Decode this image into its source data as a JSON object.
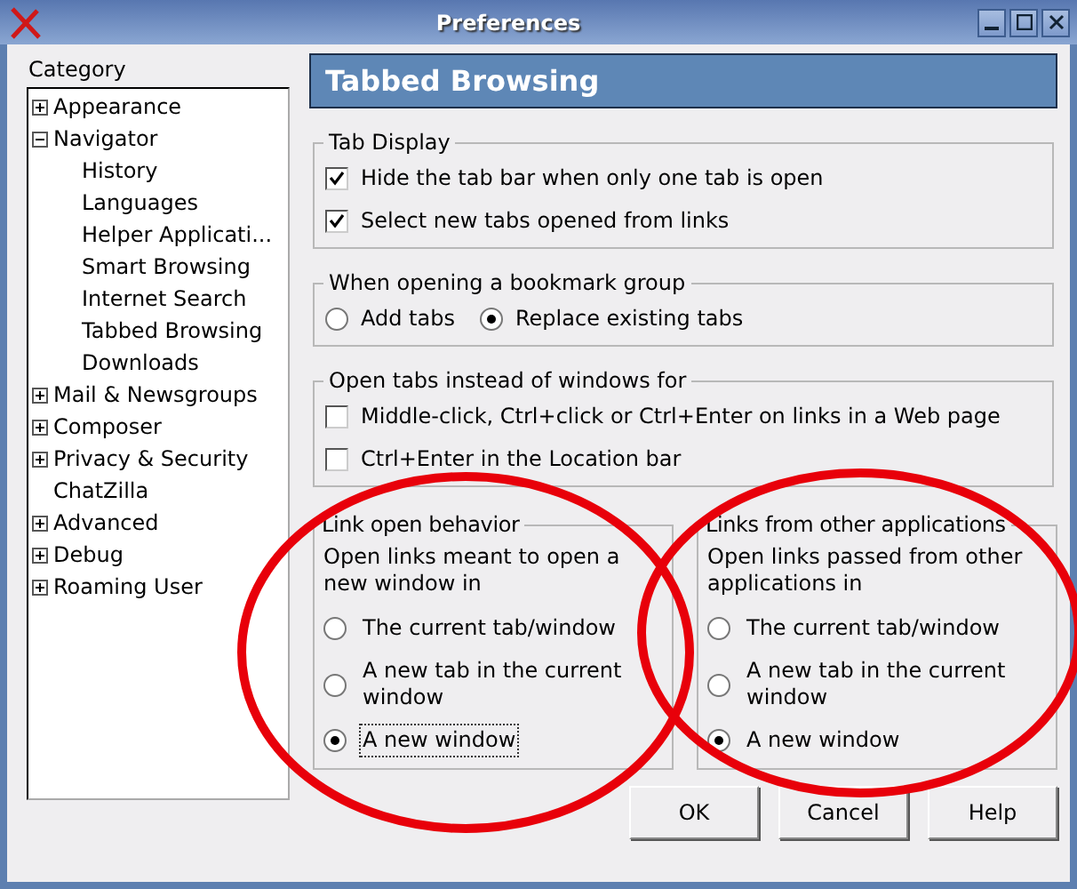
{
  "window": {
    "title": "Preferences"
  },
  "sidebar": {
    "label": "Category",
    "items": [
      {
        "label": "Appearance",
        "expanded": false
      },
      {
        "label": "Navigator",
        "expanded": true,
        "children": [
          {
            "label": "History"
          },
          {
            "label": "Languages"
          },
          {
            "label": "Helper Applicati..."
          },
          {
            "label": "Smart Browsing"
          },
          {
            "label": "Internet Search"
          },
          {
            "label": "Tabbed Browsing"
          },
          {
            "label": "Downloads"
          }
        ]
      },
      {
        "label": "Mail & Newsgroups",
        "expanded": false
      },
      {
        "label": "Composer",
        "expanded": false
      },
      {
        "label": "Privacy & Security",
        "expanded": false
      },
      {
        "label": "ChatZilla"
      },
      {
        "label": "Advanced",
        "expanded": false
      },
      {
        "label": "Debug",
        "expanded": false
      },
      {
        "label": "Roaming User",
        "expanded": false
      }
    ]
  },
  "panel_title": "Tabbed Browsing",
  "groups": [
    {
      "title": "Tab Display",
      "options": [
        {
          "kind": "checkbox",
          "label": "Hide the tab bar when only one tab is open",
          "checked": true
        },
        {
          "kind": "checkbox",
          "label": "Select new tabs opened from links",
          "checked": true
        }
      ]
    },
    {
      "title": "When opening a bookmark group",
      "options": [
        {
          "kind": "radio",
          "label": "Add tabs",
          "selected": false
        },
        {
          "kind": "radio",
          "label": "Replace existing tabs",
          "selected": true
        }
      ]
    },
    {
      "title": "Open tabs instead of windows for",
      "options": [
        {
          "kind": "checkbox",
          "label": "Middle-click, Ctrl+click or Ctrl+Enter on links in a Web page",
          "checked": false
        },
        {
          "kind": "checkbox",
          "label": "Ctrl+Enter in the Location bar",
          "checked": false
        }
      ]
    }
  ],
  "link_groups": [
    {
      "title": "Link open behavior",
      "description": "Open links meant to open a new window in",
      "options": [
        {
          "label": "The current tab/window",
          "selected": false,
          "focused": false
        },
        {
          "label": "A new tab in the current window",
          "selected": false,
          "focused": false
        },
        {
          "label": "A new window",
          "selected": true,
          "focused": true
        }
      ]
    },
    {
      "title": "Links from other applications",
      "description": "Open links passed from other applications in",
      "options": [
        {
          "label": "The current tab/window",
          "selected": false,
          "focused": false
        },
        {
          "label": "A new tab in the current window",
          "selected": false,
          "focused": false
        },
        {
          "label": "A new window",
          "selected": true,
          "focused": false
        }
      ]
    }
  ],
  "buttons": [
    "OK",
    "Cancel",
    "Help"
  ],
  "annotations": [
    {
      "kind": "ellipse"
    },
    {
      "kind": "ellipse"
    }
  ]
}
